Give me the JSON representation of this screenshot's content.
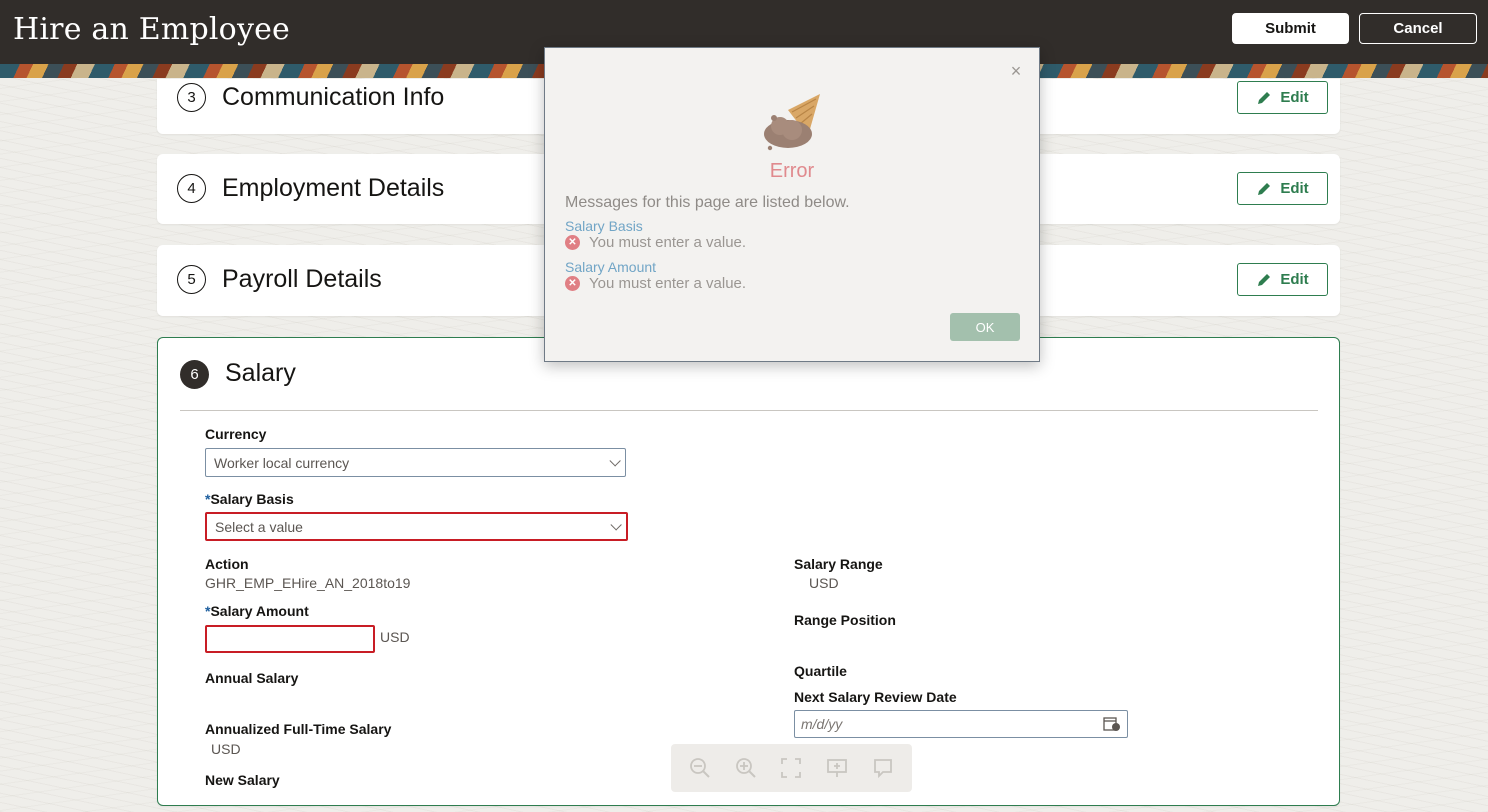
{
  "header": {
    "title": "Hire an Employee",
    "submit_label": "Submit",
    "cancel_label": "Cancel"
  },
  "sections": {
    "communication": {
      "number": "3",
      "title": "Communication Info",
      "edit_label": "Edit"
    },
    "employment": {
      "number": "4",
      "title": "Employment Details",
      "edit_label": "Edit"
    },
    "payroll": {
      "number": "5",
      "title": "Payroll Details",
      "edit_label": "Edit"
    },
    "salary": {
      "number": "6",
      "title": "Salary"
    }
  },
  "salary_form": {
    "currency_label": "Currency",
    "currency_value": "Worker local currency",
    "salary_basis_required": "*",
    "salary_basis_label": "Salary Basis",
    "salary_basis_placeholder": "Select a value",
    "action_label": "Action",
    "action_value": "GHR_EMP_EHire_AN_2018to19",
    "salary_amount_required": "*",
    "salary_amount_label": "Salary Amount",
    "salary_amount_value": "",
    "salary_amount_currency": "USD",
    "annual_salary_label": "Annual Salary",
    "annualized_label": "Annualized Full-Time Salary",
    "annualized_currency": "USD",
    "new_salary_label": "New Salary",
    "salary_range_label": "Salary Range",
    "salary_range_currency": "USD",
    "range_position_label": "Range Position",
    "quartile_label": "Quartile",
    "review_date_label": "Next Salary Review Date",
    "review_date_placeholder": "m/d/yy"
  },
  "modal": {
    "title": "Error",
    "intro": "Messages for this page are listed below.",
    "messages": [
      {
        "field": "Salary Basis",
        "text": "You must enter a value."
      },
      {
        "field": "Salary Amount",
        "text": "You must enter a value."
      }
    ],
    "ok_label": "OK",
    "close_glyph": "×"
  },
  "zoom_toolbar": {
    "icons": [
      "zoom-out-icon",
      "zoom-in-icon",
      "fit-screen-icon",
      "present-icon",
      "comment-icon"
    ]
  },
  "colors": {
    "header_bg": "#312d2a",
    "accent_green": "#2e7d4f",
    "error_red": "#c81d25",
    "link_blue": "#71a5c6"
  }
}
